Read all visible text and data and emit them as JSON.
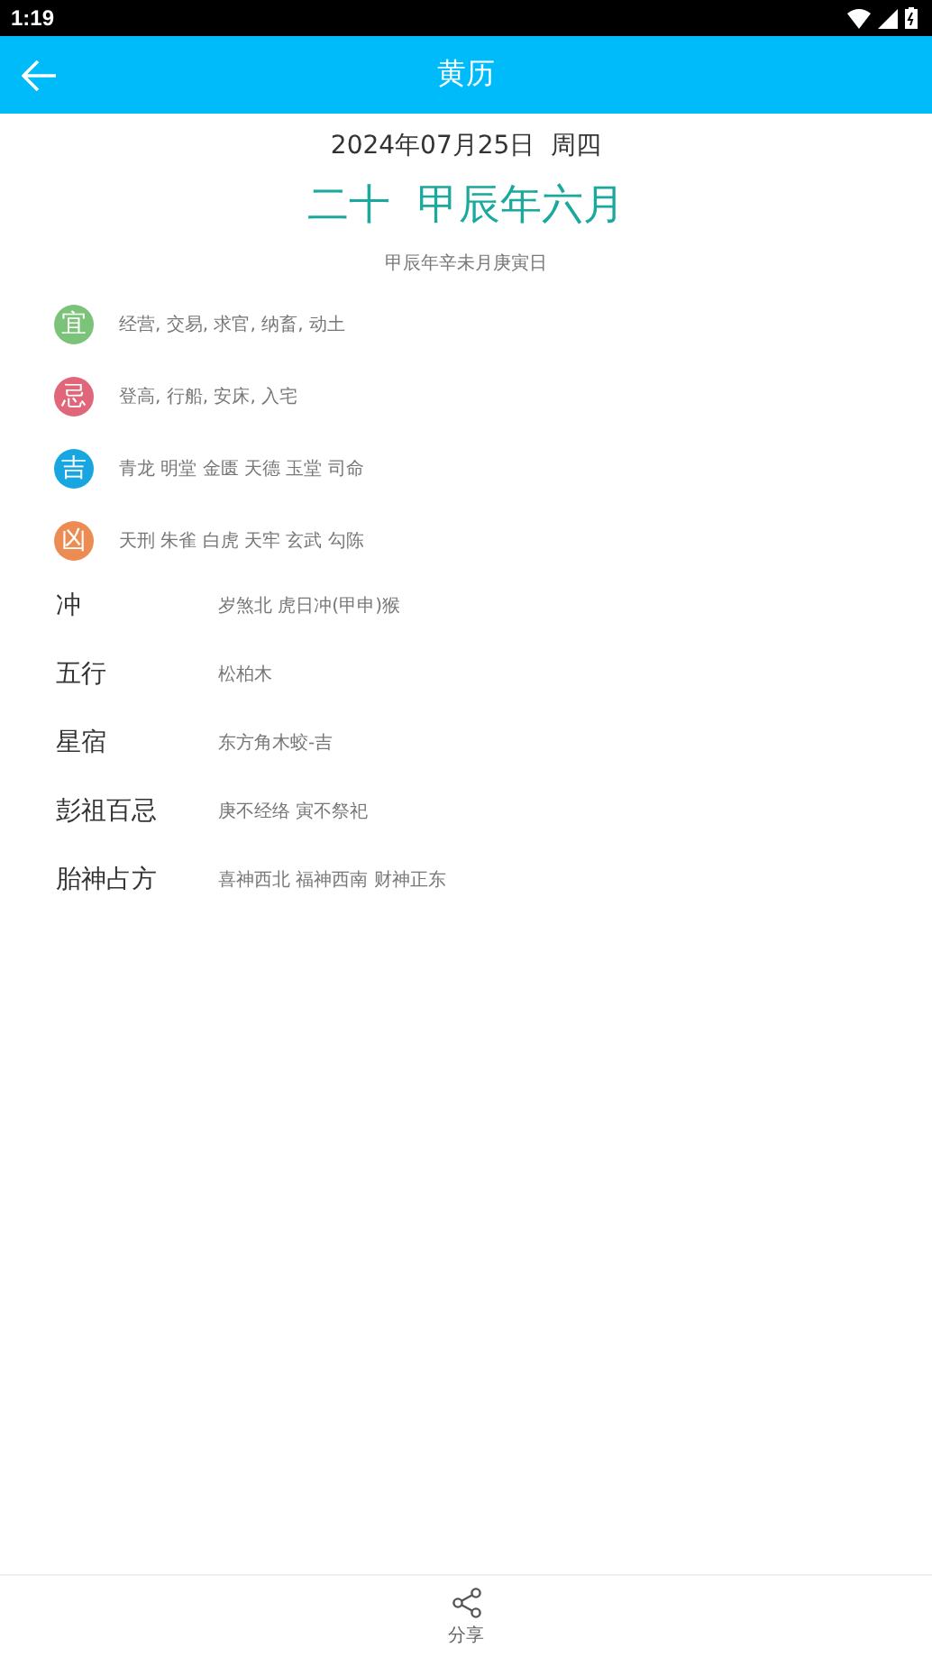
{
  "status_bar": {
    "time": "1:19"
  },
  "app_bar": {
    "title": "黄历"
  },
  "date": "2024年07月25日  周四",
  "lunar": "二十  甲辰年六月",
  "ganzhi": "甲辰年辛未月庚寅日",
  "badges": [
    {
      "mark": "宜",
      "color": "#7cc37a",
      "text": "经营, 交易, 求官, 纳畜, 动土"
    },
    {
      "mark": "忌",
      "color": "#e0667a",
      "text": "登高, 行船, 安床, 入宅"
    },
    {
      "mark": "吉",
      "color": "#17a6df",
      "text": "青龙 明堂 金匮 天德 玉堂 司命"
    },
    {
      "mark": "凶",
      "color": "#ec8c52",
      "text": "天刑 朱雀 白虎 天牢 玄武 勾陈"
    }
  ],
  "details": [
    {
      "label": "冲",
      "value": "岁煞北 虎日冲(甲申)猴"
    },
    {
      "label": "五行",
      "value": "松柏木"
    },
    {
      "label": "星宿",
      "value": "东方角木蛟-吉"
    },
    {
      "label": "彭祖百忌",
      "value": "庚不经络 寅不祭祀"
    },
    {
      "label": "胎神占方",
      "value": "喜神西北 福神西南 财神正东"
    }
  ],
  "bottom_bar": {
    "share": "分享"
  }
}
